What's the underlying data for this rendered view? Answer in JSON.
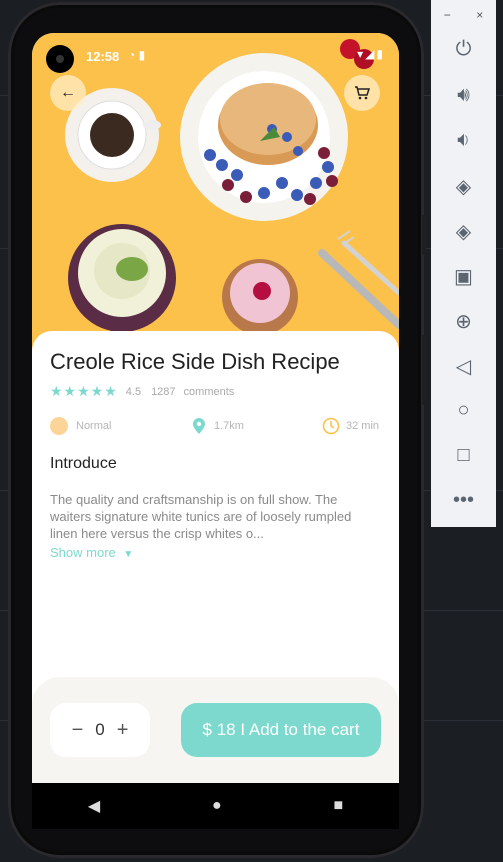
{
  "status": {
    "time": "12:58",
    "left_icons": "◔ ▮",
    "right_icons": "▾◢▮"
  },
  "recipe": {
    "title": "Creole Rice Side Dish Recipe",
    "rating": "4.5",
    "comment_count": "1287",
    "comments_label": "comments",
    "difficulty": "Normal",
    "distance": "1.7km",
    "duration": "32 min",
    "section_title": "Introduce",
    "description": "The quality and craftsmanship is on full show. The waiters  signature white tunics are of loosely rumpled linen here versus the crisp whites o...",
    "show_more": "Show more"
  },
  "cart": {
    "quantity": "0",
    "minus": "−",
    "plus": "+",
    "button_label": "$ 18 I Add to the cart"
  },
  "colors": {
    "accent": "#7dd9cd",
    "hero_bg": "#fbc14a"
  },
  "toolbar": {
    "minimize": "−",
    "close": "×"
  },
  "toolbar_icons": [
    "power-icon",
    "volume-up-icon",
    "volume-down-icon",
    "rotate-left-icon",
    "rotate-right-icon",
    "camera-icon",
    "zoom-icon",
    "back-icon",
    "home-icon",
    "overview-icon",
    "more-icon"
  ]
}
